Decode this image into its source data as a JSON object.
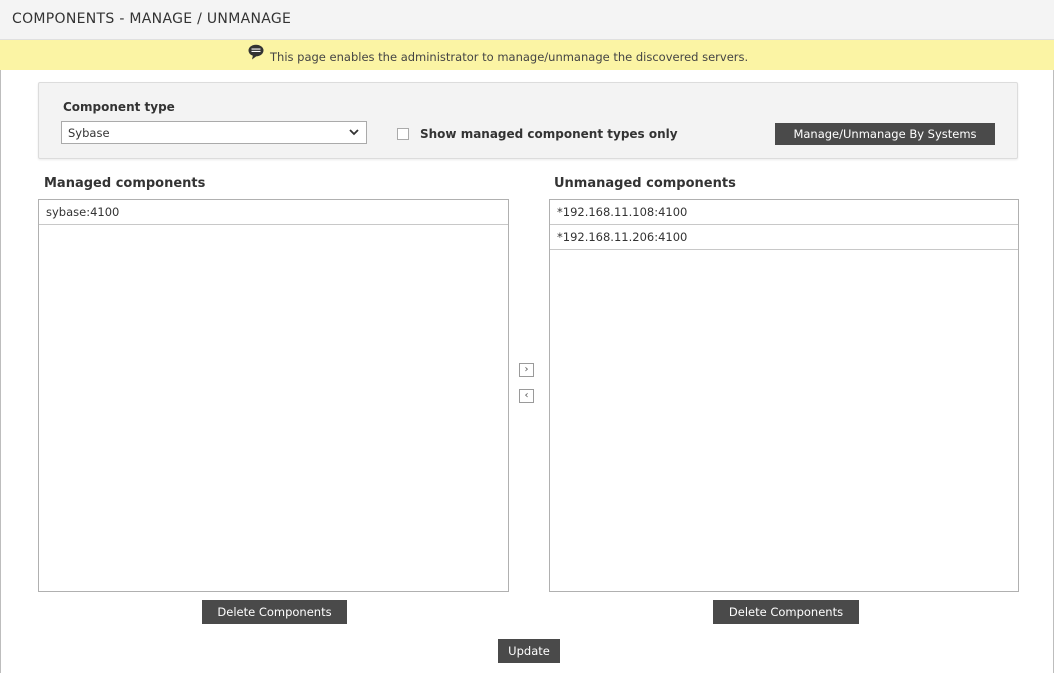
{
  "header": {
    "title": "COMPONENTS - MANAGE / UNMANAGE"
  },
  "info": {
    "icon": "speech-bubble-icon",
    "text": "This page enables the administrator to manage/unmanage the discovered servers."
  },
  "filter": {
    "component_type_label": "Component type",
    "component_type_value": "Sybase",
    "show_managed_label": "Show managed component types only",
    "show_managed_checked": false,
    "manage_by_systems_label": "Manage/Unmanage By Systems"
  },
  "managed": {
    "heading": "Managed components",
    "items": [
      "sybase:4100"
    ],
    "delete_label": "Delete Components"
  },
  "unmanaged": {
    "heading": "Unmanaged components",
    "items": [
      "*192.168.11.108:4100",
      "*192.168.11.206:4100"
    ],
    "delete_label": "Delete Components"
  },
  "transfer": {
    "move_right": "›",
    "move_left": "‹"
  },
  "footer": {
    "update_label": "Update"
  },
  "colors": {
    "info_bar": "#fbf4a4",
    "button_dark": "#4a4a4a"
  }
}
